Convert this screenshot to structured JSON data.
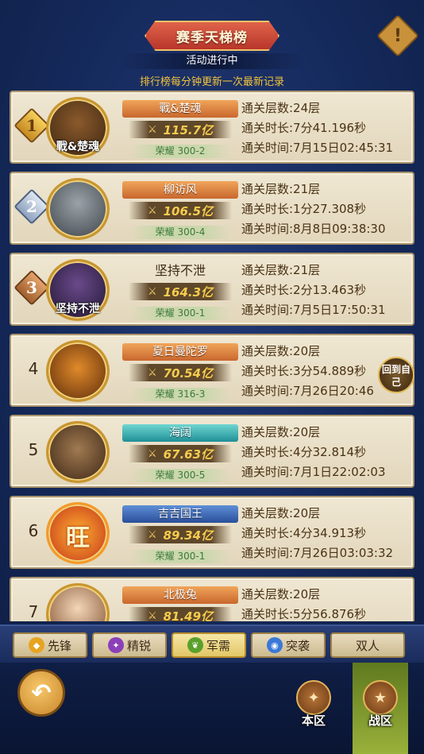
{
  "header": {
    "title": "赛季天梯榜",
    "status": "活动进行中",
    "update_note": "排行榜每分钟更新一次最新记录",
    "alert_icon": "!"
  },
  "labels": {
    "layers": "通关层数:",
    "duration": "通关时长:",
    "time": "通关时间:"
  },
  "rows": [
    {
      "rank": "1",
      "name": "戰&楚魂",
      "avatar_name": "戰&楚魂",
      "power": "115.7亿",
      "server": "荣耀  300-2",
      "layers": "通关层数:24层",
      "duration": "通关时长:7分41.196秒",
      "time": "通关时间:7月15日02:45:31"
    },
    {
      "rank": "2",
      "name": "柳访风",
      "avatar_name": "",
      "power": "106.5亿",
      "server": "荣耀  300-4",
      "layers": "通关层数:21层",
      "duration": "通关时长:1分27.308秒",
      "time": "通关时间:8月8日09:38:30"
    },
    {
      "rank": "3",
      "name": "坚持不泄",
      "avatar_name": "坚持不泄",
      "power": "164.3亿",
      "server": "荣耀  300-1",
      "layers": "通关层数:21层",
      "duration": "通关时长:2分13.463秒",
      "time": "通关时间:7月5日17:50:31"
    },
    {
      "rank": "4",
      "name": "夏日曼陀罗",
      "avatar_name": "",
      "power": "70.54亿",
      "server": "荣耀  316-3",
      "layers": "通关层数:20层",
      "duration": "通关时长:3分54.889秒",
      "time": "通关时间:7月26日20:46"
    },
    {
      "rank": "5",
      "name": "海阔",
      "avatar_name": "",
      "power": "67.63亿",
      "server": "荣耀  300-5",
      "layers": "通关层数:20层",
      "duration": "通关时长:4分32.814秒",
      "time": "通关时间:7月1日22:02:03"
    },
    {
      "rank": "6",
      "name": "吉吉国王",
      "avatar_name": "旺",
      "power": "89.34亿",
      "server": "荣耀  300-1",
      "layers": "通关层数:20层",
      "duration": "通关时长:4分34.913秒",
      "time": "通关时间:7月26日03:03:32"
    },
    {
      "rank": "7",
      "name": "北极兔",
      "avatar_name": "",
      "power": "81.49亿",
      "server": "",
      "layers": "通关层数:20层",
      "duration": "通关时长:5分56.876秒",
      "time": ""
    }
  ],
  "return_btn": "回到自己",
  "tabs": [
    {
      "label": "先锋",
      "icon": "shield-icon",
      "color": "#e6a421"
    },
    {
      "label": "精锐",
      "icon": "claw-icon",
      "color": "#8b3fb8"
    },
    {
      "label": "军需",
      "icon": "leaf-icon",
      "color": "#5aa02c"
    },
    {
      "label": "突袭",
      "icon": "vortex-icon",
      "color": "#3a78d8"
    },
    {
      "label": "双人",
      "icon": "",
      "color": ""
    }
  ],
  "active_tab": "军需",
  "nav": {
    "back_icon": "↶",
    "local_label": "本区",
    "war_label": "战区"
  }
}
